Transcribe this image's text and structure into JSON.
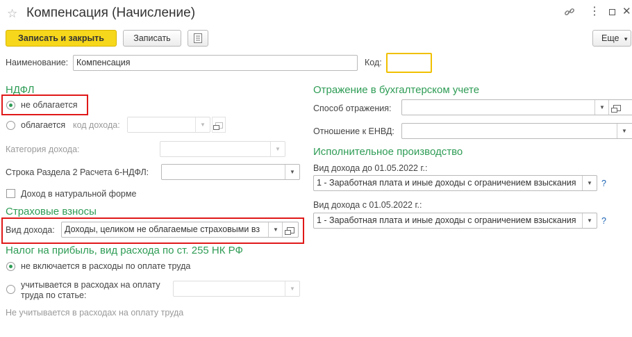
{
  "window": {
    "title": "Компенсация (Начисление)",
    "link_icon": "link-icon",
    "more_icon": "more-icon",
    "maximize_icon": "maximize-icon",
    "close_icon": "close-icon"
  },
  "toolbar": {
    "save_close_label": "Записать и закрыть",
    "save_label": "Записать",
    "more_label": "Еще",
    "more_arrow": "▾"
  },
  "form": {
    "name_label": "Наименование:",
    "name_value": "Компенсация",
    "code_label": "Код:",
    "code_value": ""
  },
  "ndfl": {
    "section_title": "НДФЛ",
    "not_taxed_label": "не облагается",
    "taxed_label": "облагается",
    "income_code_label": "код дохода:",
    "income_category_label": "Категория дохода:",
    "line_label": "Строка Раздела 2 Расчета 6-НДФЛ:",
    "in_kind_label": "Доход в натуральной форме"
  },
  "insurance": {
    "section_title": "Страховые взносы",
    "income_type_label": "Вид дохода:",
    "income_type_value": "Доходы, целиком не облагаемые страховыми вз"
  },
  "profit_tax": {
    "section_title": "Налог на прибыль, вид расхода по ст. 255 НК РФ",
    "not_included_label": "не включается в расходы по оплате труда",
    "accounted_label_1": "учитывается в расходах на оплату",
    "accounted_label_2": "труда по статье:",
    "note": "Не учитывается в расходах на оплату труда"
  },
  "accounting": {
    "section_title": "Отражение в бухгалтерском учете",
    "method_label": "Способ отражения:",
    "envd_label": "Отношение к ЕНВД:"
  },
  "enforcement": {
    "section_title": "Исполнительное производство",
    "before_label": "Вид дохода до 01.05.2022 г.:",
    "before_value": "1 - Заработная плата и иные доходы с ограничением взыскания",
    "after_label": "Вид дохода с 01.05.2022 г.:",
    "after_value": "1 - Заработная плата и иные доходы с ограничением взыскания",
    "help": "?"
  },
  "colors": {
    "accent_green": "#2e9c55",
    "primary_button": "#f6d71b",
    "highlight_red": "#e01818",
    "code_field_border": "#f0c000"
  }
}
